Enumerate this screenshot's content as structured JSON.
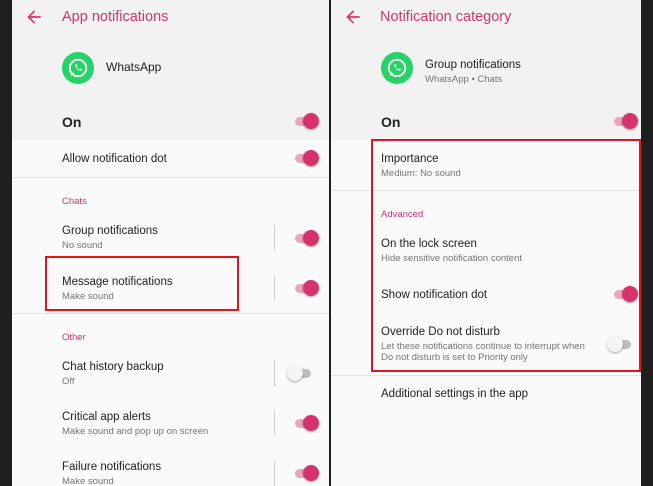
{
  "left": {
    "title": "App notifications",
    "app_name": "WhatsApp",
    "on_label": "On",
    "allow_dot_label": "Allow notification dot",
    "chats_header": "Chats",
    "group": {
      "title": "Group notifications",
      "subtitle": "No sound"
    },
    "message": {
      "title": "Message notifications",
      "subtitle": "Make sound"
    },
    "other_header": "Other",
    "backup": {
      "title": "Chat history backup",
      "subtitle": "Off"
    },
    "critical": {
      "title": "Critical app alerts",
      "subtitle": "Make sound and pop up on screen"
    },
    "failure": {
      "title": "Failure notifications",
      "subtitle": "Make sound"
    }
  },
  "right": {
    "title": "Notification category",
    "category_title": "Group notifications",
    "category_subtitle": "WhatsApp • Chats",
    "on_label": "On",
    "importance": {
      "title": "Importance",
      "subtitle": "Medium: No sound"
    },
    "advanced_header": "Advanced",
    "lock_screen": {
      "title": "On the lock screen",
      "subtitle": "Hide sensitive notification content"
    },
    "show_dot_label": "Show notification dot",
    "override": {
      "title": "Override Do not disturb",
      "subtitle_line1": "Let these notifications continue to interrupt when",
      "subtitle_line2": "Do not disturb is set to Priority only"
    },
    "additional_label": "Additional settings in the app"
  },
  "toggles": {
    "left_on": true,
    "left_allow_dot": true,
    "left_group": true,
    "left_message": true,
    "left_backup": false,
    "left_critical": true,
    "left_failure": true,
    "right_on": true,
    "right_show_dot": true,
    "right_override": false
  },
  "colors": {
    "accent": "#d6336c",
    "highlight": "#e0141e",
    "whatsapp": "#25d366"
  },
  "icons": {
    "back": "back-arrow-icon",
    "app": "whatsapp-icon"
  }
}
